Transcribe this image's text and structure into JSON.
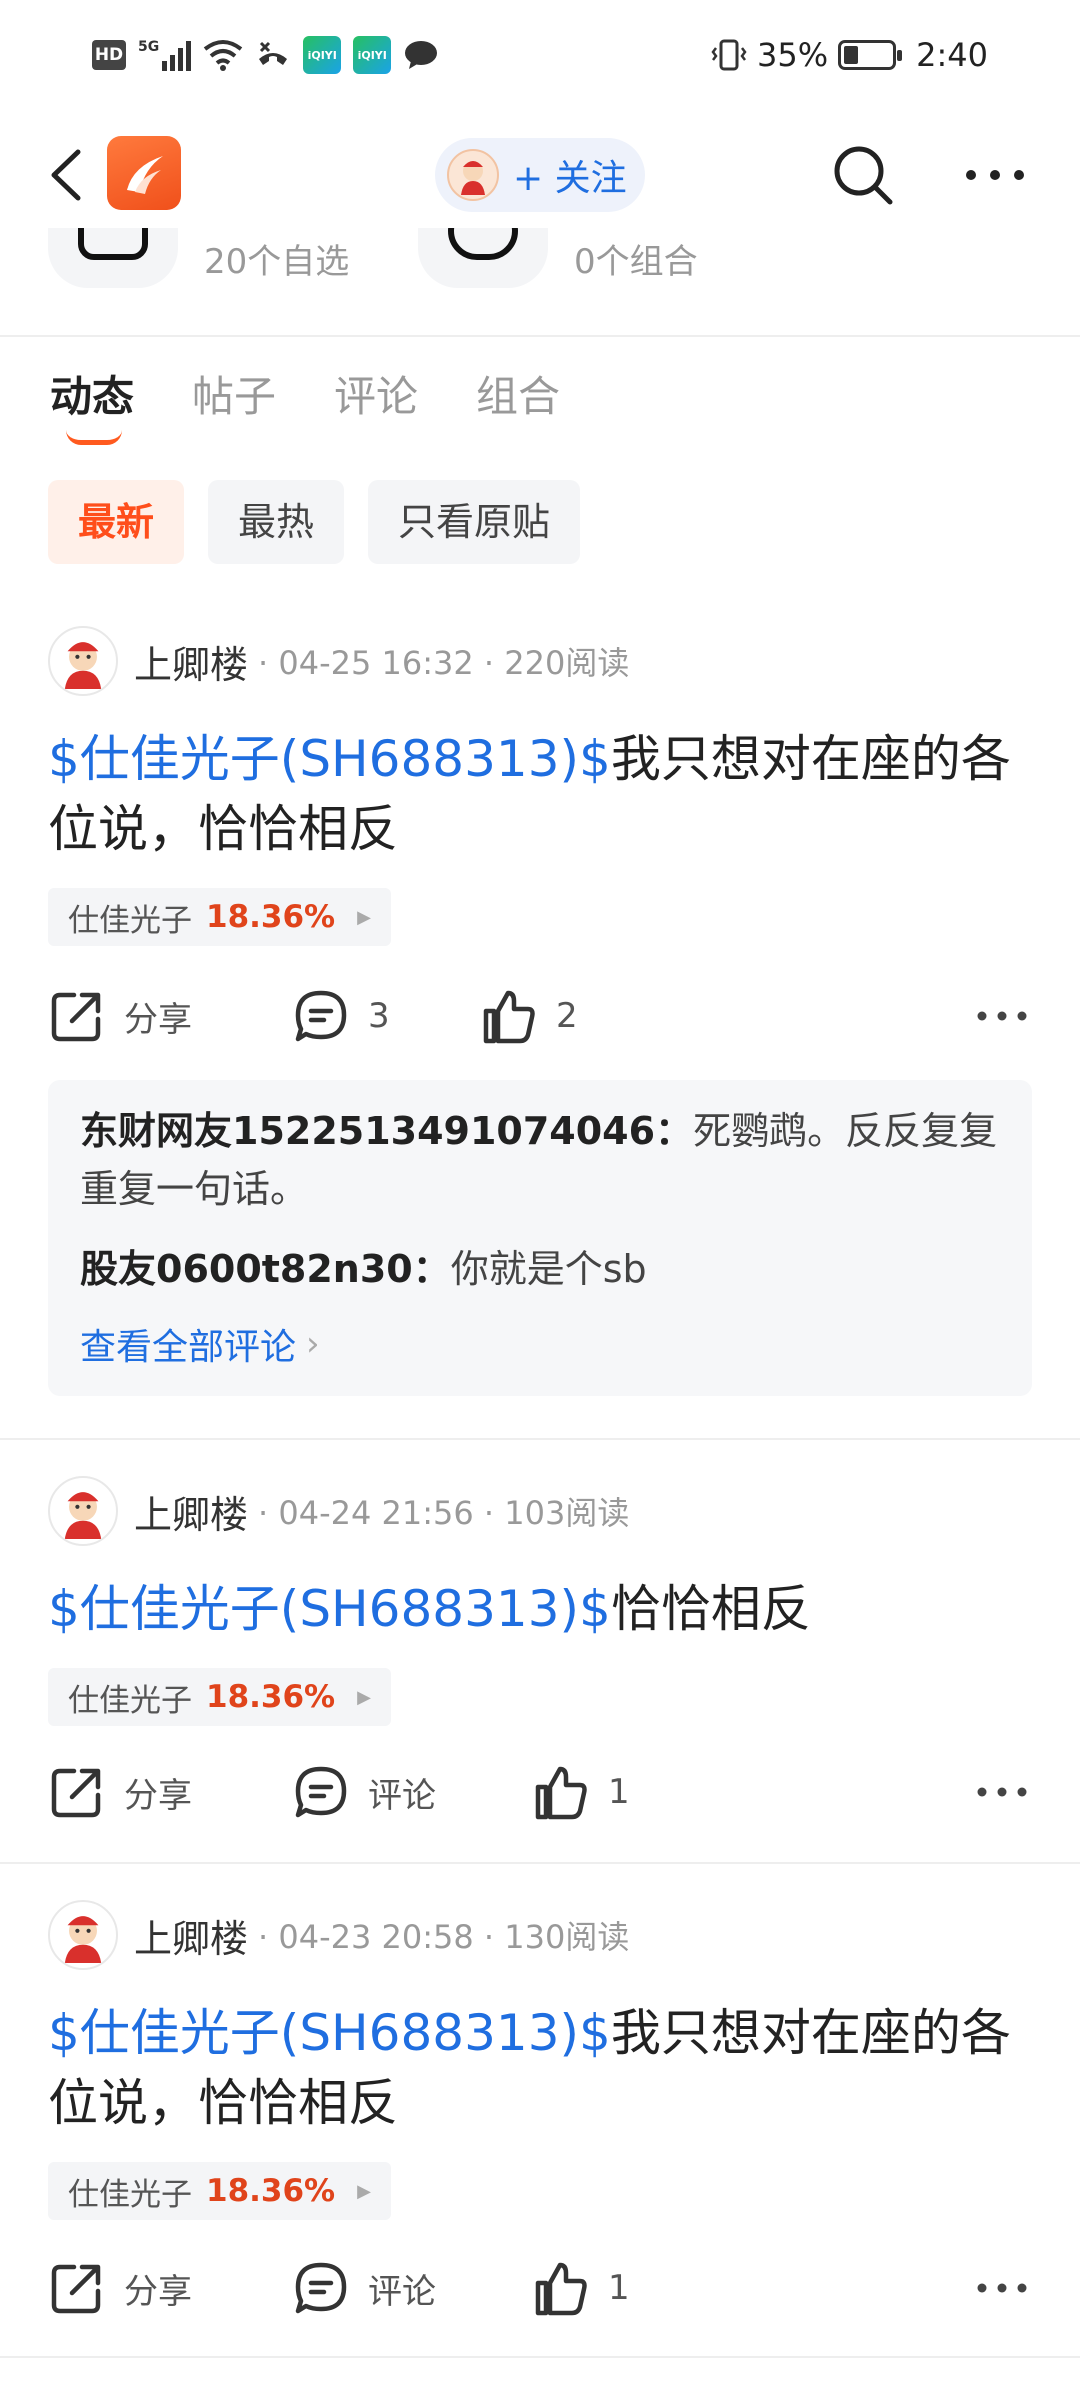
{
  "status_bar": {
    "hd": "HD",
    "network": "5G",
    "battery": "35%",
    "time": "2:40",
    "app_tile_label": "iQIYI"
  },
  "header": {
    "follow_label": "+ 关注"
  },
  "stats": [
    {
      "text": "20个自选"
    },
    {
      "text": "0个组合"
    }
  ],
  "tabs": [
    {
      "label": "动态",
      "active": true
    },
    {
      "label": "帖子"
    },
    {
      "label": "评论"
    },
    {
      "label": "组合"
    }
  ],
  "filters": [
    {
      "label": "最新",
      "active": true
    },
    {
      "label": "最热"
    },
    {
      "label": "只看原贴"
    }
  ],
  "posts": [
    {
      "author": "上卿楼",
      "meta": "· 04-25 16:32 · 220阅读",
      "stock_tag": "$仕佳光子(SH688313)$",
      "content": "我只想对在座的各位说，恰恰相反",
      "chip_name": "仕佳光子",
      "chip_pct": "18.36%",
      "share": "分享",
      "comment": "3",
      "like": "2",
      "comments": [
        {
          "user": "东财网友1522513491074046：",
          "text": "死鹦鹉。反反复复重复一句话。"
        },
        {
          "user": "股友0600t82n30：",
          "text": "你就是个sb"
        }
      ],
      "see_all": "查看全部评论"
    },
    {
      "author": "上卿楼",
      "meta": "· 04-24 21:56 · 103阅读",
      "stock_tag": "$仕佳光子(SH688313)$",
      "content": "恰恰相反",
      "chip_name": "仕佳光子",
      "chip_pct": "18.36%",
      "share": "分享",
      "comment": "评论",
      "like": "1"
    },
    {
      "author": "上卿楼",
      "meta": "· 04-23 20:58 · 130阅读",
      "stock_tag": "$仕佳光子(SH688313)$",
      "content": "我只想对在座的各位说，恰恰相反",
      "chip_name": "仕佳光子",
      "chip_pct": "18.36%",
      "share": "分享",
      "comment": "评论",
      "like": "1"
    }
  ],
  "colors": {
    "accent": "#ff5a1f",
    "link": "#1f6ee0",
    "rise": "#e0441b"
  }
}
